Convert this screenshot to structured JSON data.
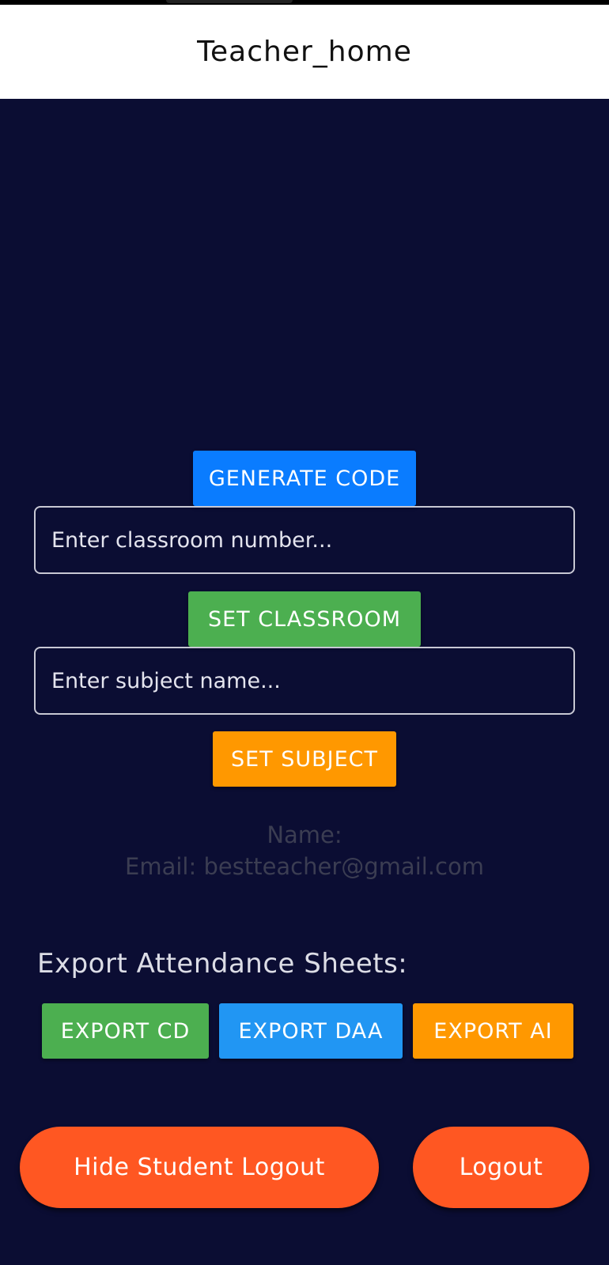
{
  "header": {
    "title": "Teacher_home"
  },
  "buttons": {
    "generate_code": "GENERATE CODE",
    "set_classroom": "SET CLASSROOM",
    "set_subject": "SET SUBJECT"
  },
  "inputs": {
    "classroom_placeholder": "Enter classroom number...",
    "subject_placeholder": "Enter subject name..."
  },
  "info": {
    "name_line": "Name:",
    "email_line": "Email: bestteacher@gmail.com"
  },
  "export": {
    "heading": "Export Attendance Sheets:",
    "cd": "EXPORT CD",
    "daa": "EXPORT DAA",
    "ai": "EXPORT AI"
  },
  "footer": {
    "hide_student_logout": "Hide Student Logout",
    "logout": "Logout"
  },
  "colors": {
    "background": "#0b0d33",
    "blue": "#0a7cff",
    "green": "#4caf50",
    "orange": "#ff9800",
    "export_blue": "#2196f3",
    "pill": "#ff5722"
  }
}
